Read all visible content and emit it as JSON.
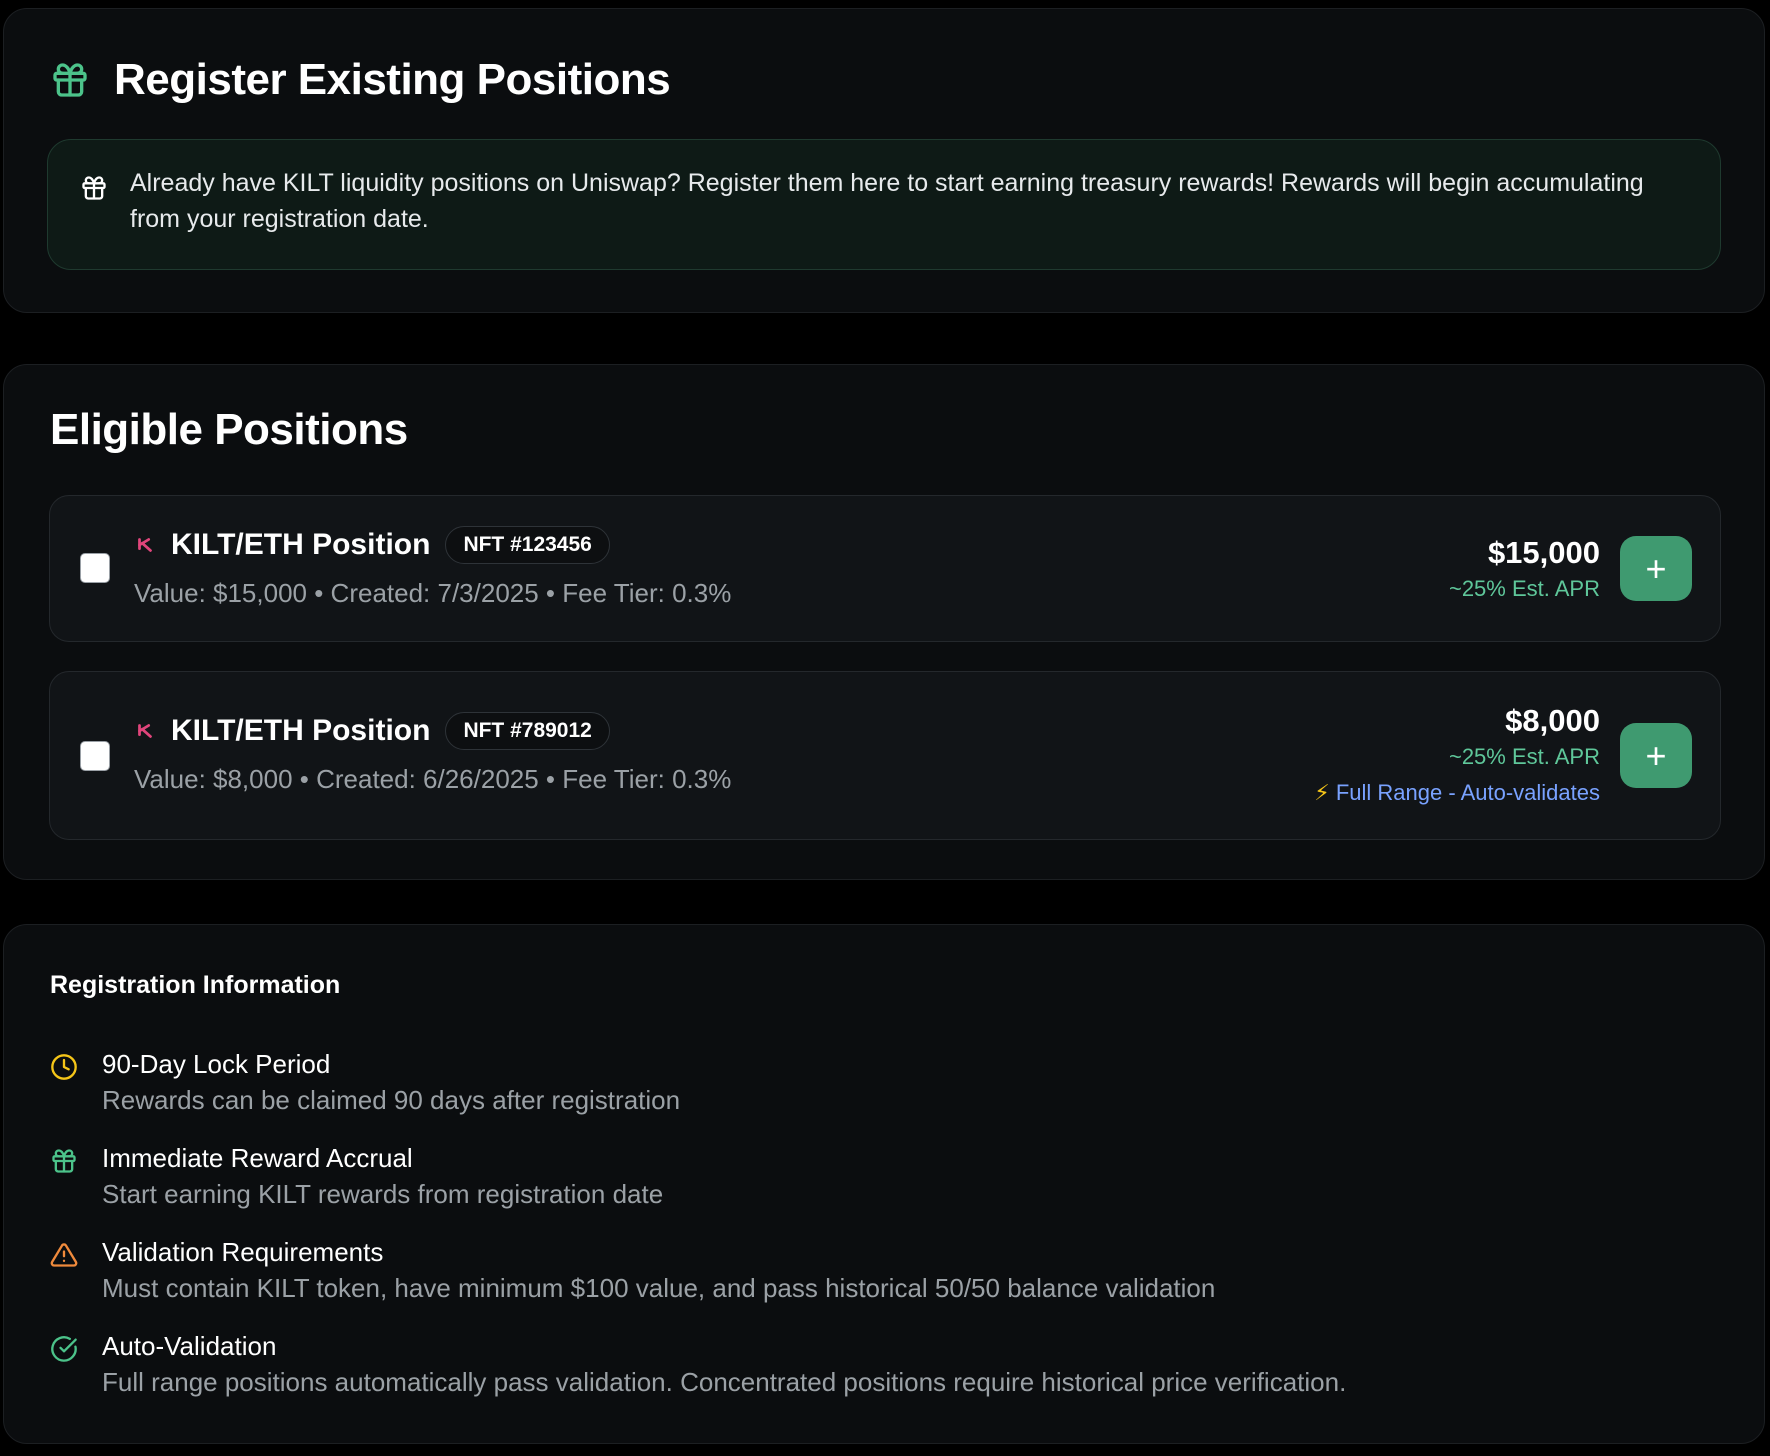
{
  "register": {
    "title": "Register Existing Positions",
    "notice": "Already have KILT liquidity positions on Uniswap? Register them here to start earning treasury rewards! Rewards will begin accumulating from your registration date."
  },
  "eligible": {
    "title": "Eligible Positions",
    "positions": [
      {
        "name": "KILT/ETH Position",
        "nft": "NFT #123456",
        "meta": "Value: $15,000 • Created: 7/3/2025 • Fee Tier: 0.3%",
        "value": "$15,000",
        "apr": "~25% Est. APR",
        "add_label": "+"
      },
      {
        "name": "KILT/ETH Position",
        "nft": "NFT #789012",
        "meta": "Value: $8,000 • Created: 6/26/2025 • Fee Tier: 0.3%",
        "value": "$8,000",
        "apr": "~25% Est. APR",
        "range_icon": "⚡",
        "range_text": "Full Range - Auto-validates",
        "add_label": "+"
      }
    ]
  },
  "info": {
    "title": "Registration Information",
    "items": [
      {
        "icon": "clock-icon",
        "title": "90-Day Lock Period",
        "desc": "Rewards can be claimed 90 days after registration"
      },
      {
        "icon": "gift-icon",
        "title": "Immediate Reward Accrual",
        "desc": "Start earning KILT rewards from registration date"
      },
      {
        "icon": "warning-icon",
        "title": "Validation Requirements",
        "desc": "Must contain KILT token, have minimum $100 value, and pass historical 50/50 balance validation"
      },
      {
        "icon": "check-circle-icon",
        "title": "Auto-Validation",
        "desc": "Full range positions automatically pass validation. Concentrated positions require historical price verification."
      }
    ]
  },
  "colors": {
    "accent_green": "#3f9a70",
    "apr_green": "#5fc79a",
    "range_blue": "#79a2ff",
    "kilt_pink": "#e0457b",
    "clock_yellow": "#f5c518",
    "warning_orange": "#f08a3c"
  }
}
